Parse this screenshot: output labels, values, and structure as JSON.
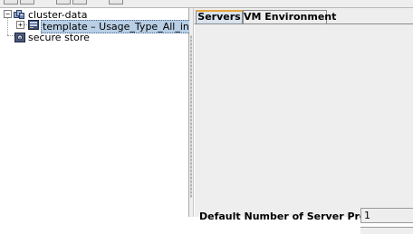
{
  "toolbar": {
    "buttons": [
      "toolbar-button-1",
      "toolbar-button-2",
      "toolbar-button-3",
      "toolbar-button-4",
      "toolbar-button-5"
    ]
  },
  "tree": {
    "nodes": [
      {
        "label": "cluster-data",
        "icon": "cluster-icon",
        "expander": "−"
      },
      {
        "label": "template – Usage_Type_All_in_One",
        "icon": "server-template-icon",
        "expander": "+",
        "selected": true
      },
      {
        "label": "secure store",
        "icon": "secure-store-icon"
      }
    ]
  },
  "tabs": [
    {
      "label": "Servers",
      "active": true
    },
    {
      "label": "VM Environment",
      "active": false
    }
  ],
  "fields": {
    "default_server_processes": {
      "label": "Default Number of Server Processes",
      "value": "1"
    }
  },
  "colors": {
    "selection_bg": "#b8cfe5",
    "active_tab_bg": "#d9e3ee",
    "active_tab_accent": "#e8a53a",
    "panel_bg": "#eeeeee"
  }
}
